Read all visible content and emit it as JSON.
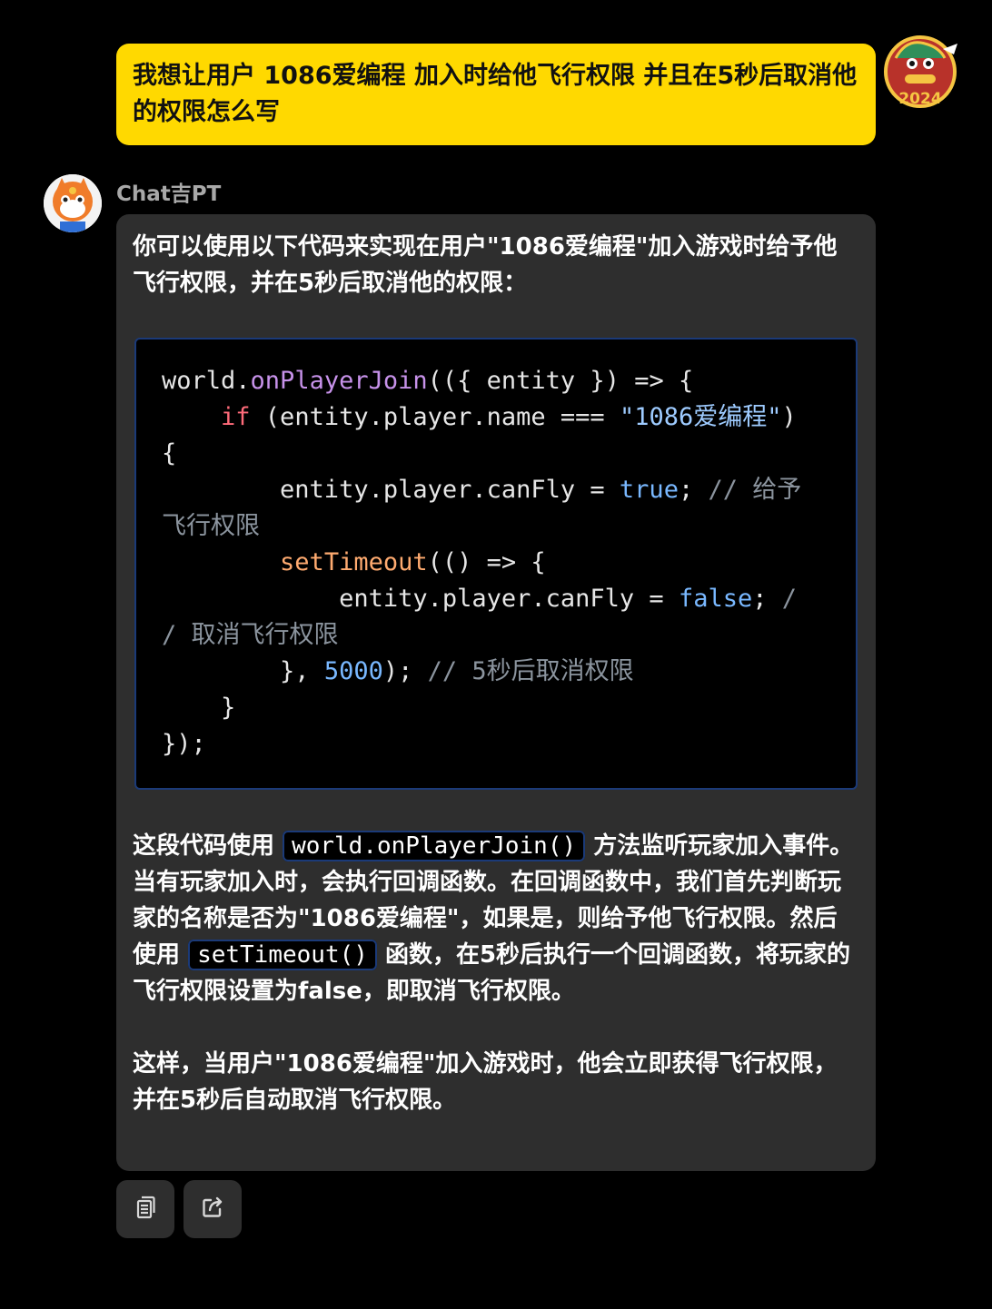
{
  "user_message": {
    "text": "我想让用户 1086爱编程 加入时给他飞行权限 并且在5秒后取消他的权限怎么写",
    "avatar_icon": "dragon-2024-avatar-icon",
    "bubble_color": "#ffd900"
  },
  "bot": {
    "name": "Chat吉PT",
    "avatar_icon": "orange-mascot-avatar-icon",
    "intro": "你可以使用以下代码来实现在用户\"1086爱编程\"加入游戏时给予他飞行权限，并在5秒后取消他的权限：",
    "code": {
      "lines": [
        [
          {
            "t": "world.",
            "c": ""
          },
          {
            "t": "onPlayerJoin",
            "c": "fn"
          },
          {
            "t": "(({ entity }) => {",
            "c": ""
          }
        ],
        [
          {
            "t": "    ",
            "c": ""
          },
          {
            "t": "if",
            "c": "kw"
          },
          {
            "t": " (entity.player.name === ",
            "c": ""
          },
          {
            "t": "\"1086爱编程\"",
            "c": "str"
          },
          {
            "t": ")",
            "c": ""
          }
        ],
        [
          {
            "t": "{",
            "c": ""
          }
        ],
        [
          {
            "t": "        entity.player.canFly = ",
            "c": ""
          },
          {
            "t": "true",
            "c": "bool"
          },
          {
            "t": "; ",
            "c": ""
          },
          {
            "t": "// 给予",
            "c": "cmt"
          }
        ],
        [
          {
            "t": "飞行权限",
            "c": "cmt"
          }
        ],
        [
          {
            "t": "        ",
            "c": ""
          },
          {
            "t": "setTimeout",
            "c": "orange"
          },
          {
            "t": "(() => {",
            "c": ""
          }
        ],
        [
          {
            "t": "            entity.player.canFly = ",
            "c": ""
          },
          {
            "t": "false",
            "c": "bool"
          },
          {
            "t": "; ",
            "c": ""
          },
          {
            "t": "/",
            "c": "cmt"
          }
        ],
        [
          {
            "t": "/ 取消飞行权限",
            "c": "cmt"
          }
        ],
        [
          {
            "t": "        }, ",
            "c": ""
          },
          {
            "t": "5000",
            "c": "num"
          },
          {
            "t": "); ",
            "c": ""
          },
          {
            "t": "// 5秒后取消权限",
            "c": "cmt"
          }
        ],
        [
          {
            "t": "    }",
            "c": ""
          }
        ],
        [
          {
            "t": "});",
            "c": ""
          }
        ]
      ]
    },
    "explain": {
      "part1": "这段代码使用 ",
      "code1": "world.onPlayerJoin()",
      "part2": " 方法监听玩家加入事件。当有玩家加入时，会执行回调函数。在回调函数中，我们首先判断玩家的名称是否为\"1086爱编程\"，如果是，则给予他飞行权限。然后使用 ",
      "code2": "setTimeout()",
      "part3": " 函数，在5秒后执行一个回调函数，将玩家的飞行权限设置为false，即取消飞行权限。"
    },
    "summary": "这样，当用户\"1086爱编程\"加入游戏时，他会立即获得飞行权限，并在5秒后自动取消飞行权限。"
  },
  "actions": {
    "copy_icon": "copy-icon",
    "share_icon": "share-icon"
  }
}
